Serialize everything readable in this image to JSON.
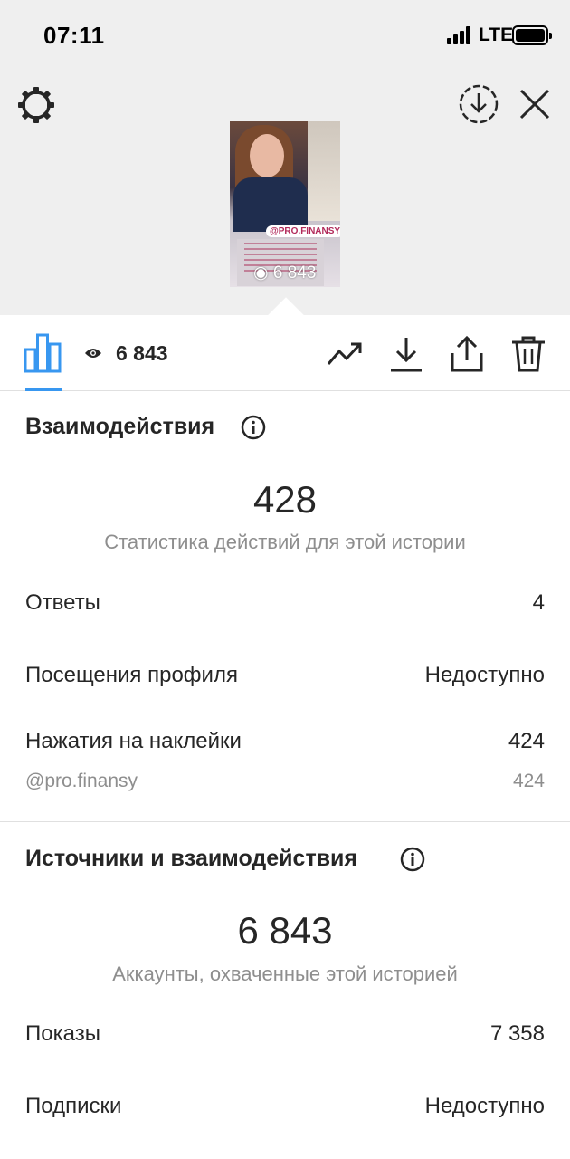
{
  "status_bar": {
    "time": "07:11",
    "network": "LTE"
  },
  "story": {
    "sticker_tag": "@PRO.FINANSY",
    "views": "6 843"
  },
  "toolbar": {
    "views": "6 843"
  },
  "interactions": {
    "title": "Взаимодействия",
    "total": "428",
    "subtitle": "Статистика действий для этой истории",
    "rows": [
      {
        "label": "Ответы",
        "value": "4"
      },
      {
        "label": "Посещения профиля",
        "value": "Недоступно"
      },
      {
        "label": "Нажатия на наклейки",
        "value": "424"
      }
    ],
    "sticker": {
      "label": "@pro.finansy",
      "value": "424"
    }
  },
  "discovery": {
    "title": "Источники и взаимодействия",
    "total": "6 843",
    "subtitle": "Аккаунты, охваченные этой историей",
    "rows": [
      {
        "label": "Показы",
        "value": "7 358"
      },
      {
        "label": "Подписки",
        "value": "Недоступно"
      }
    ]
  },
  "colors": {
    "accent": "#3897f0",
    "text": "#262626",
    "muted": "#8e8e8e",
    "header_bg": "#efefef"
  }
}
